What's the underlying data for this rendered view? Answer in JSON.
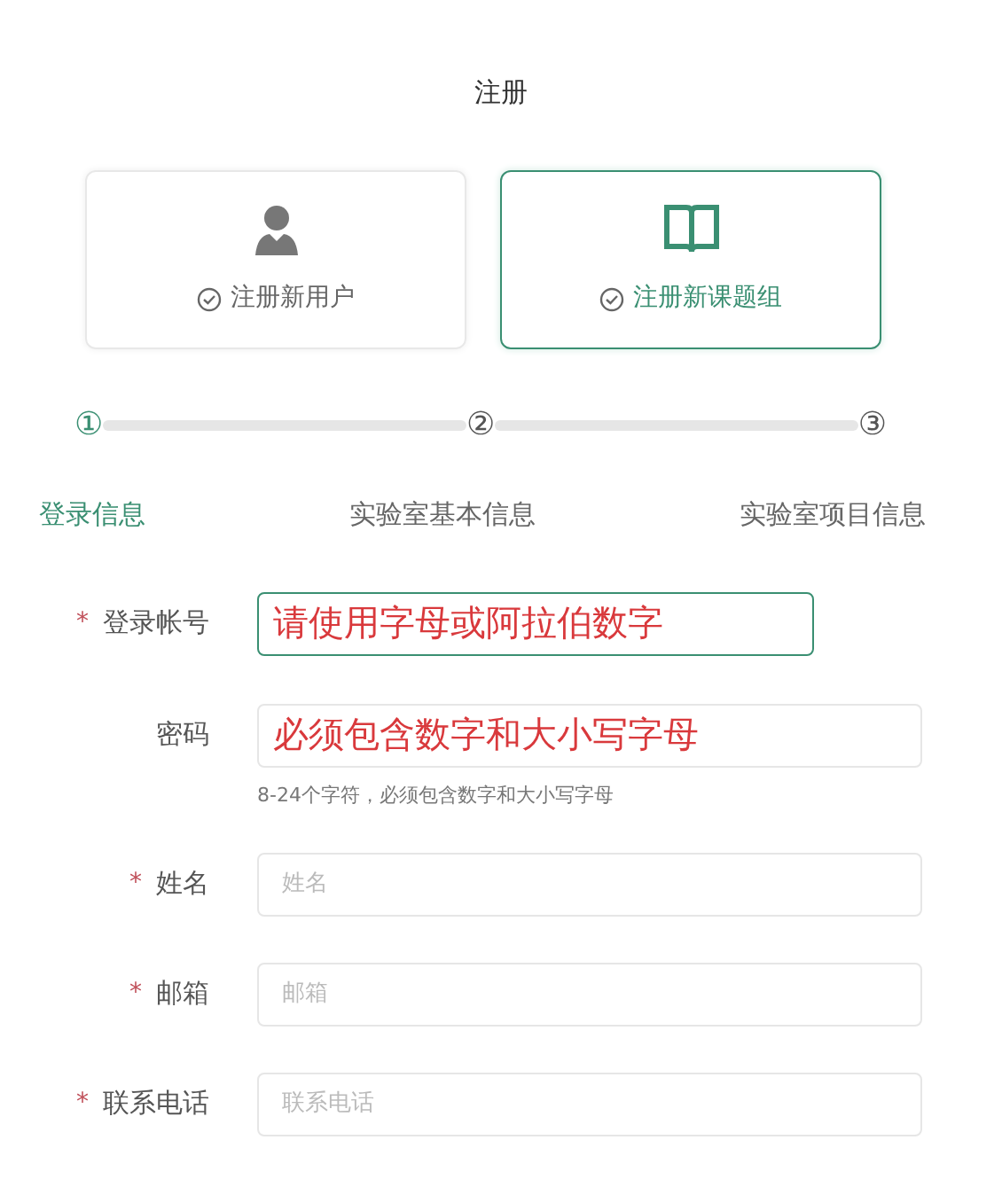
{
  "title": "注册",
  "options": [
    {
      "label": "注册新用户",
      "kind": "user",
      "selected": false
    },
    {
      "label": "注册新课题组",
      "kind": "book",
      "selected": true
    }
  ],
  "steps": [
    {
      "number": "①",
      "label": "登录信息",
      "selected": true
    },
    {
      "number": "②",
      "label": "实验室基本信息",
      "selected": false
    },
    {
      "number": "③",
      "label": "实验室项目信息",
      "selected": false
    }
  ],
  "fields": [
    {
      "required_mark": "*",
      "label": "登录帐号",
      "value": "请使用字母或阿拉伯数字",
      "focused": true
    },
    {
      "label": "密码",
      "value": "必须包含数字和大小写字母",
      "focused": false,
      "hint": "8-24个字符，必须包含数字和大小写字母"
    },
    {
      "required_mark": "*",
      "label": "姓名",
      "placeholder": "姓名",
      "focused": false
    },
    {
      "required_mark": "*",
      "label": "邮箱",
      "placeholder": "邮箱",
      "focused": false
    },
    {
      "required_mark": "*",
      "label": "联系电话",
      "placeholder": "联系电话",
      "focused": false
    }
  ]
}
